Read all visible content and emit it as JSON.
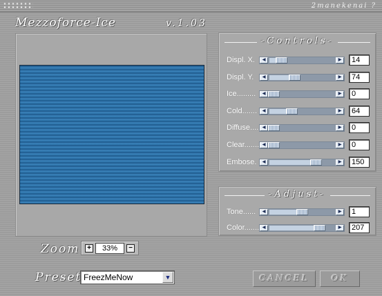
{
  "window": {
    "title": "Mezzoforce-Ice",
    "version": "v.1.03",
    "brand": "2manekenai ?"
  },
  "controls": {
    "title": "-Controls-",
    "sliders": [
      {
        "label": "Displ. X.",
        "value": "14",
        "fraction": 0.14
      },
      {
        "label": "Displ. Y.",
        "value": "74",
        "fraction": 0.37
      },
      {
        "label": "Ice.........",
        "value": "0",
        "fraction": 0.0
      },
      {
        "label": "Cold.......",
        "value": "64",
        "fraction": 0.32
      },
      {
        "label": "Diffuse....",
        "value": "0",
        "fraction": 0.0
      },
      {
        "label": "Clear.......",
        "value": "0",
        "fraction": 0.0
      },
      {
        "label": "Embose.",
        "value": "150",
        "fraction": 0.75
      }
    ]
  },
  "adjust": {
    "title": "-Adjust-",
    "sliders": [
      {
        "label": "Tone......",
        "value": "1",
        "fraction": 0.5
      },
      {
        "label": "Color.......",
        "value": "207",
        "fraction": 0.81
      }
    ]
  },
  "zoom": {
    "label": "Zoom",
    "value": "33%",
    "minus": "−",
    "plus": "+"
  },
  "preset": {
    "label": "Preset",
    "selected": "FreezMeNow",
    "dropdown_icon": "chevron-down-icon"
  },
  "buttons": {
    "cancel": "CANCEL",
    "ok": "OK"
  },
  "colors": {
    "background": "#9c9c9c",
    "preview_blue": "#2a6ea4",
    "slider_track": "#8d99a8"
  }
}
